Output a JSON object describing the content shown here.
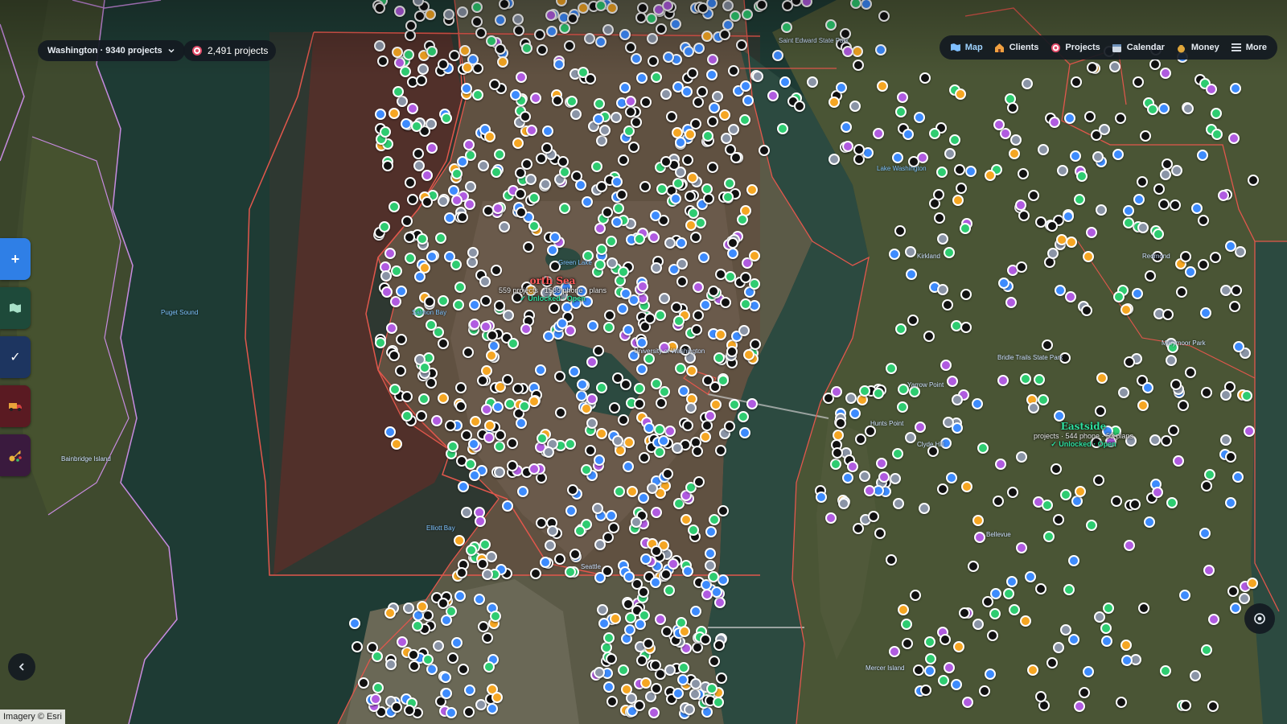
{
  "region_selector": {
    "label": "Washington · 9340 projects",
    "icon": "chevron-down-icon"
  },
  "project_count": {
    "label": "2,491 projects",
    "icon": "target-icon"
  },
  "nav": [
    {
      "label": "Map",
      "icon": "map-icon",
      "active": true
    },
    {
      "label": "Clients",
      "icon": "house-icon",
      "active": false
    },
    {
      "label": "Projects",
      "icon": "target-icon",
      "active": false
    },
    {
      "label": "Calendar",
      "icon": "calendar-icon",
      "active": false
    },
    {
      "label": "Money",
      "icon": "money-bag-icon",
      "active": false
    },
    {
      "label": "More",
      "icon": "menu-icon",
      "active": false
    }
  ],
  "tools": [
    {
      "name": "add-button",
      "icon": "plus-icon",
      "color": "#2f7fe6"
    },
    {
      "name": "map-layer-button",
      "icon": "map-icon",
      "color": "#1e4a3a"
    },
    {
      "name": "check-button",
      "icon": "check-icon",
      "color": "#1d3560"
    },
    {
      "name": "truck-button",
      "icon": "truck-icon",
      "color": "#5a1a22"
    },
    {
      "name": "key-button",
      "icon": "key-icon",
      "color": "#3a1a3e"
    }
  ],
  "regions": [
    {
      "name": "North Seattle",
      "name_shown": "orth Sea",
      "stats": "559 projects · 1589 phone · plans",
      "status": "✓ Unlocked · Open",
      "accent": "#ff5a5a"
    },
    {
      "name": "Eastside",
      "name_shown": "Eastside",
      "stats": "projects · 544 phone · 53 plans",
      "status": "✓ Unlocked · Open",
      "accent": "#2fe0a0"
    }
  ],
  "map_labels": [
    "Puget Sound",
    "Bainbridge Island",
    "Elliott Bay",
    "Seattle",
    "Lake Washington",
    "Kirkland",
    "Redmond",
    "Bellevue",
    "Mercer Island",
    "Yarrow Point",
    "Hunts Point",
    "Clyde Hill",
    "Green Lake",
    "Salmon Bay",
    "University of Washington",
    "Bridle Trails State Park",
    "Saint Edward State Park",
    "Marymoor Park"
  ],
  "colors": {
    "status_black": "#111111",
    "status_green": "#2ecc71",
    "status_blue": "#3d8bfd",
    "status_orange": "#f5a623",
    "status_purple": "#b05be0",
    "status_gray": "#8a94a6",
    "boundary": "#e2574c",
    "region_overlay": "#a0302a"
  },
  "attribution": "Imagery © Esri",
  "collapse_icon": "chevron-left-icon",
  "locate_icon": "locate-icon"
}
